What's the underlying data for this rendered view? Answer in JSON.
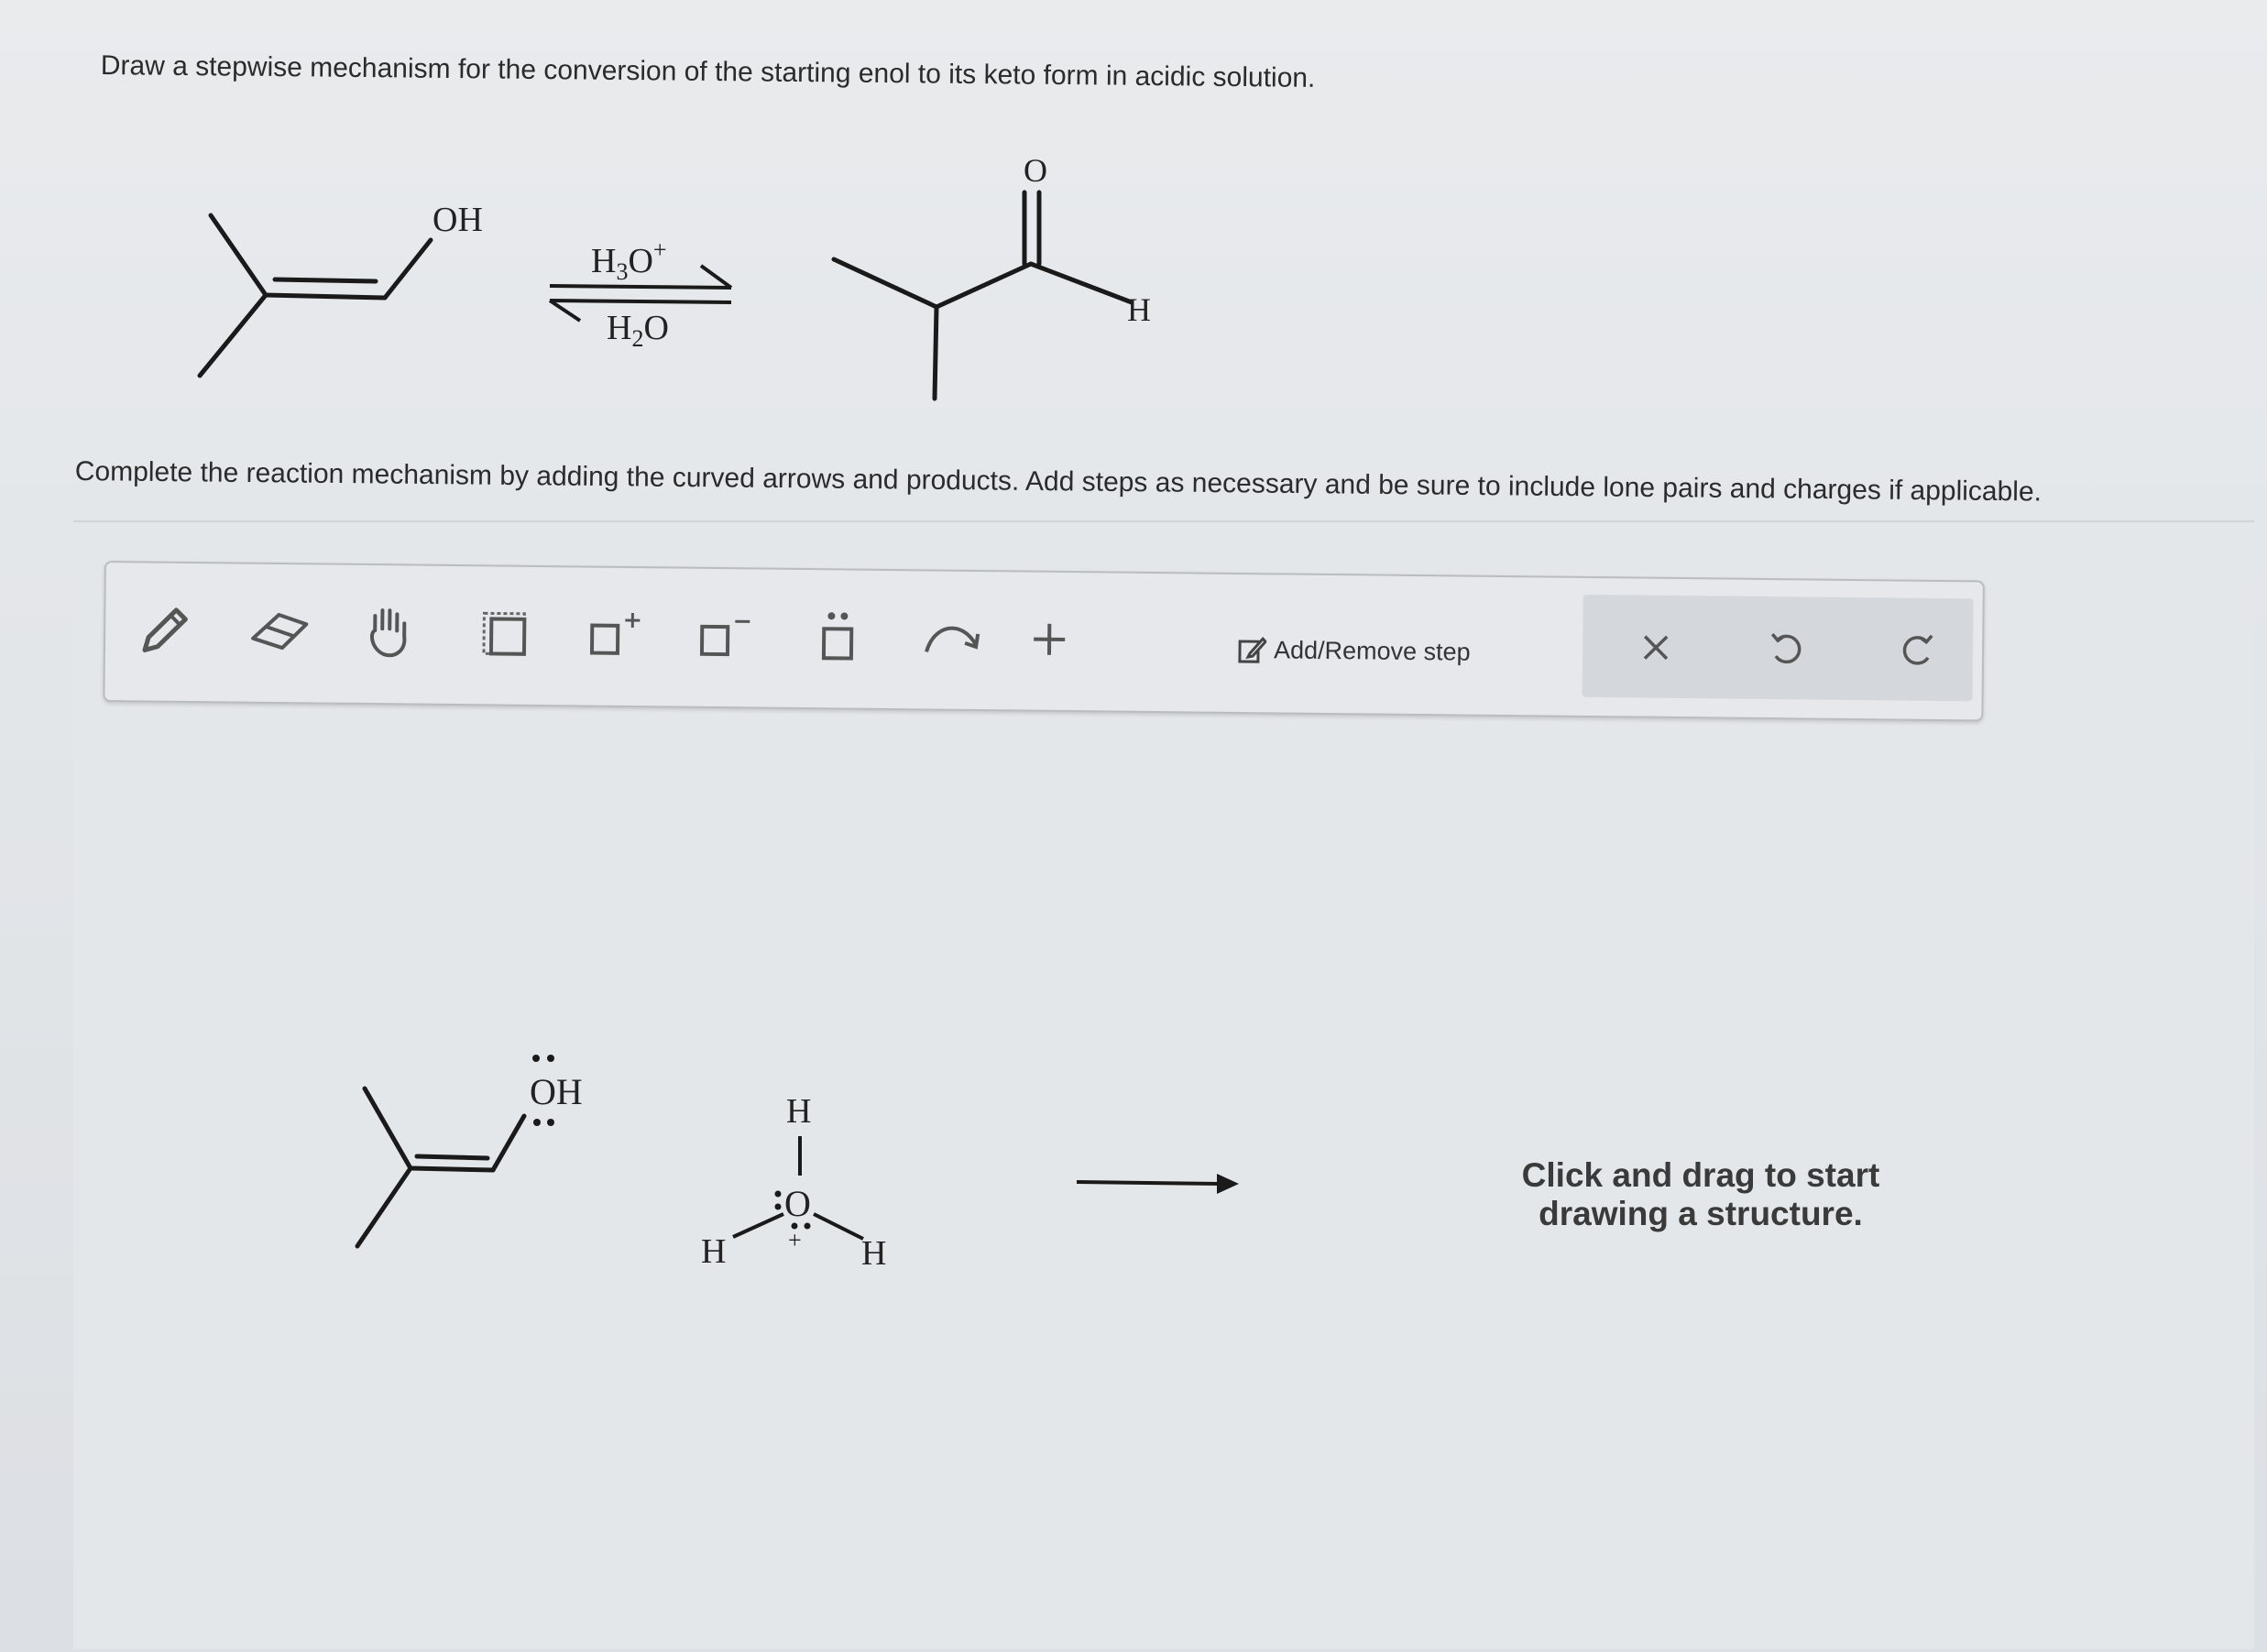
{
  "question": {
    "prompt": "Draw a stepwise mechanism for the conversion of the starting enol to its keto form in acidic solution.",
    "instruction": "Complete the reaction mechanism by adding the curved arrows and products. Add steps as necessary and be sure to include lone pairs and charges if applicable."
  },
  "reaction": {
    "enol_label": "OH",
    "reagent_top": "H3O+",
    "reagent_bottom": "H2O",
    "product_o": "O",
    "product_h": "H"
  },
  "toolbar": {
    "add_remove_step": "Add/Remove step",
    "plus_label": "+",
    "tools": [
      "pencil-icon",
      "eraser-icon",
      "hand-icon",
      "select-box-icon",
      "positive-charge-icon",
      "negative-charge-icon",
      "lone-pair-icon",
      "curved-arrow-icon",
      "add-icon"
    ],
    "right_tools": [
      "close-icon",
      "undo-icon",
      "redo-icon"
    ]
  },
  "canvas": {
    "enol_label": "OH",
    "hydronium_h_top": "H",
    "hydronium_o": "O",
    "hydronium_h_left": "H",
    "hydronium_h_right": "H",
    "charge": "+",
    "hint": "Click and drag to start drawing a structure."
  }
}
